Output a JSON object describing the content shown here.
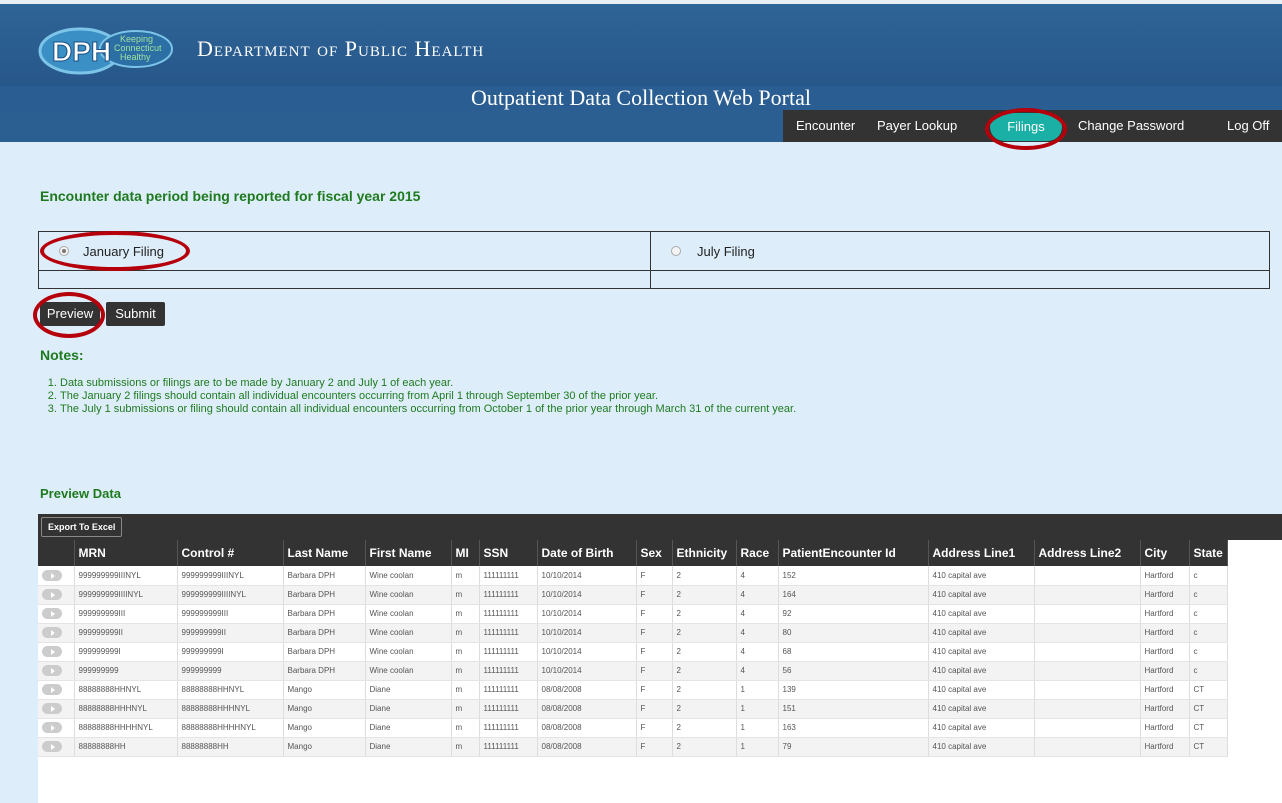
{
  "header": {
    "logo_text": "DPH",
    "logo_tagline": "Keeping Connecticut Healthy",
    "department": "Department of Public Health",
    "portal_title": "Outpatient Data Collection Web Portal",
    "nav": [
      "Encounter",
      "Payer Lookup",
      "Filings",
      "Change Password",
      "Log Off"
    ],
    "active_nav": "Filings"
  },
  "filing": {
    "heading": "Encounter data period being reported for fiscal year 2015",
    "options": [
      {
        "label": "January Filing",
        "selected": true
      },
      {
        "label": "July Filing",
        "selected": false
      }
    ]
  },
  "buttons": {
    "preview": "Preview",
    "submit": "Submit"
  },
  "notes": {
    "title": "Notes:",
    "items": [
      "Data submissions or filings are to be made by January 2 and July 1 of each year.",
      "The January 2 filings should contain all individual encounters occurring from April 1 through September 30 of the prior year.",
      "The July 1 submissions or filing should contain all individual encounters occurring from October 1 of the prior year through March 31 of the current year."
    ]
  },
  "preview": {
    "title": "Preview Data",
    "export_label": "Export To Excel",
    "columns": [
      "",
      "MRN",
      "Control #",
      "Last Name",
      "First Name",
      "MI",
      "SSN",
      "Date of Birth",
      "Sex",
      "Ethnicity",
      "Race",
      "PatientEncounter Id",
      "Address Line1",
      "Address Line2",
      "City",
      "State"
    ],
    "rows": [
      [
        "999999999IIINYL",
        "999999999IIINYL",
        "Barbara DPH",
        "Wine coolan",
        "m",
        "111111111",
        "10/10/2014",
        "F",
        "2",
        "4",
        "152",
        "410 capital ave",
        "",
        "Hartford",
        "c"
      ],
      [
        "999999999IIIINYL",
        "999999999IIIINYL",
        "Barbara DPH",
        "Wine coolan",
        "m",
        "111111111",
        "10/10/2014",
        "F",
        "2",
        "4",
        "164",
        "410 capital ave",
        "",
        "Hartford",
        "c"
      ],
      [
        "999999999III",
        "999999999III",
        "Barbara DPH",
        "Wine coolan",
        "m",
        "111111111",
        "10/10/2014",
        "F",
        "2",
        "4",
        "92",
        "410 capital ave",
        "",
        "Hartford",
        "c"
      ],
      [
        "999999999II",
        "999999999II",
        "Barbara DPH",
        "Wine coolan",
        "m",
        "111111111",
        "10/10/2014",
        "F",
        "2",
        "4",
        "80",
        "410 capital ave",
        "",
        "Hartford",
        "c"
      ],
      [
        "999999999I",
        "999999999I",
        "Barbara DPH",
        "Wine coolan",
        "m",
        "111111111",
        "10/10/2014",
        "F",
        "2",
        "4",
        "68",
        "410 capital ave",
        "",
        "Hartford",
        "c"
      ],
      [
        "999999999",
        "999999999",
        "Barbara DPH",
        "Wine coolan",
        "m",
        "111111111",
        "10/10/2014",
        "F",
        "2",
        "4",
        "56",
        "410 capital ave",
        "",
        "Hartford",
        "c"
      ],
      [
        "88888888HHNYL",
        "88888888HHNYL",
        "Mango",
        "Diane",
        "m",
        "111111111",
        "08/08/2008",
        "F",
        "2",
        "1",
        "139",
        "410 capital ave",
        "",
        "Hartford",
        "CT"
      ],
      [
        "88888888HHHNYL",
        "88888888HHHNYL",
        "Mango",
        "Diane",
        "m",
        "111111111",
        "08/08/2008",
        "F",
        "2",
        "1",
        "151",
        "410 capital ave",
        "",
        "Hartford",
        "CT"
      ],
      [
        "88888888HHHHNYL",
        "88888888HHHHNYL",
        "Mango",
        "Diane",
        "m",
        "111111111",
        "08/08/2008",
        "F",
        "2",
        "1",
        "163",
        "410 capital ave",
        "",
        "Hartford",
        "CT"
      ],
      [
        "88888888HH",
        "88888888HH",
        "Mango",
        "Diane",
        "m",
        "111111111",
        "08/08/2008",
        "F",
        "2",
        "1",
        "79",
        "410 capital ave",
        "",
        "Hartford",
        "CT"
      ]
    ]
  },
  "colors": {
    "header": "#2a5a8a",
    "nav_active": "#1ab0a5",
    "highlight_ring": "#b5000c",
    "green_text": "#1f7a1f",
    "page_bg": "#ddeefa"
  }
}
